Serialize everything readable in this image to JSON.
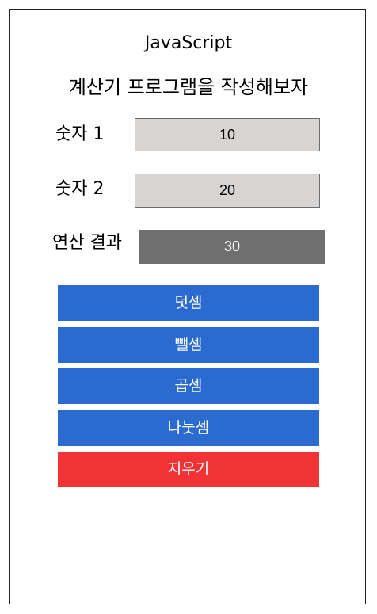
{
  "header": {
    "title": "JavaScript",
    "subtitle": "계산기 프로그램을 작성해보자"
  },
  "inputs": {
    "number1": {
      "label": "숫자 1",
      "value": "10"
    },
    "number2": {
      "label": "숫자 2",
      "value": "20"
    }
  },
  "result": {
    "label": "연산 결과",
    "value": "30"
  },
  "buttons": {
    "add": "덧셈",
    "subtract": "뺄셈",
    "multiply": "곱셈",
    "divide": "나눗셈",
    "clear": "지우기"
  },
  "colors": {
    "operation_button": "#2b6bd0",
    "clear_button": "#f13336",
    "input_background": "#d7d5d3",
    "result_background": "#6f6f6f"
  }
}
